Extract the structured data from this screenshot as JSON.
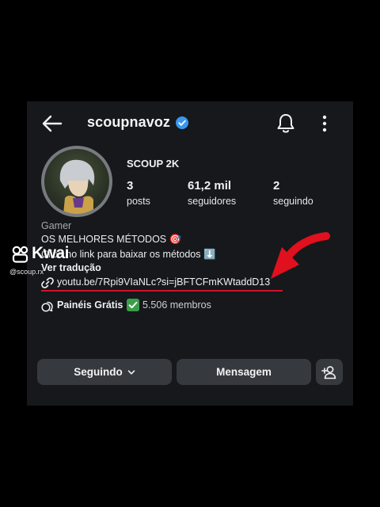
{
  "header": {
    "back_icon": "arrow-left-icon",
    "username": "scoupnavoz",
    "verified_icon": "verified-badge-icon",
    "verified_color": "#3897f0",
    "bell_icon": "notification-bell-icon",
    "more_icon": "more-vertical-icon"
  },
  "profile": {
    "display_name": "SCOUP 2K",
    "stats": [
      {
        "value": "3",
        "label": "posts"
      },
      {
        "value": "61,2 mil",
        "label": "seguidores"
      },
      {
        "value": "2",
        "label": "seguindo"
      }
    ]
  },
  "bio": {
    "category": "Gamer",
    "line1": "OS MELHORES MÉTODOS 🎯",
    "line2": "Clica no link para baixar os métodos ⬇️",
    "translate_label": "Ver tradução",
    "link": "youtu.be/7Rpi9VIaNLc?si=jBFTCFmKWtaddD13",
    "channel_name": "Painéis Grátis",
    "channel_count": "5.506 membros"
  },
  "actions": {
    "following_label": "Seguindo",
    "message_label": "Mensagem",
    "add_person_icon": "add-person-icon"
  },
  "overlay": {
    "watermark_brand": "Kwai",
    "watermark_handle": "@scoup.rx",
    "arrow_color": "#e0101e"
  }
}
